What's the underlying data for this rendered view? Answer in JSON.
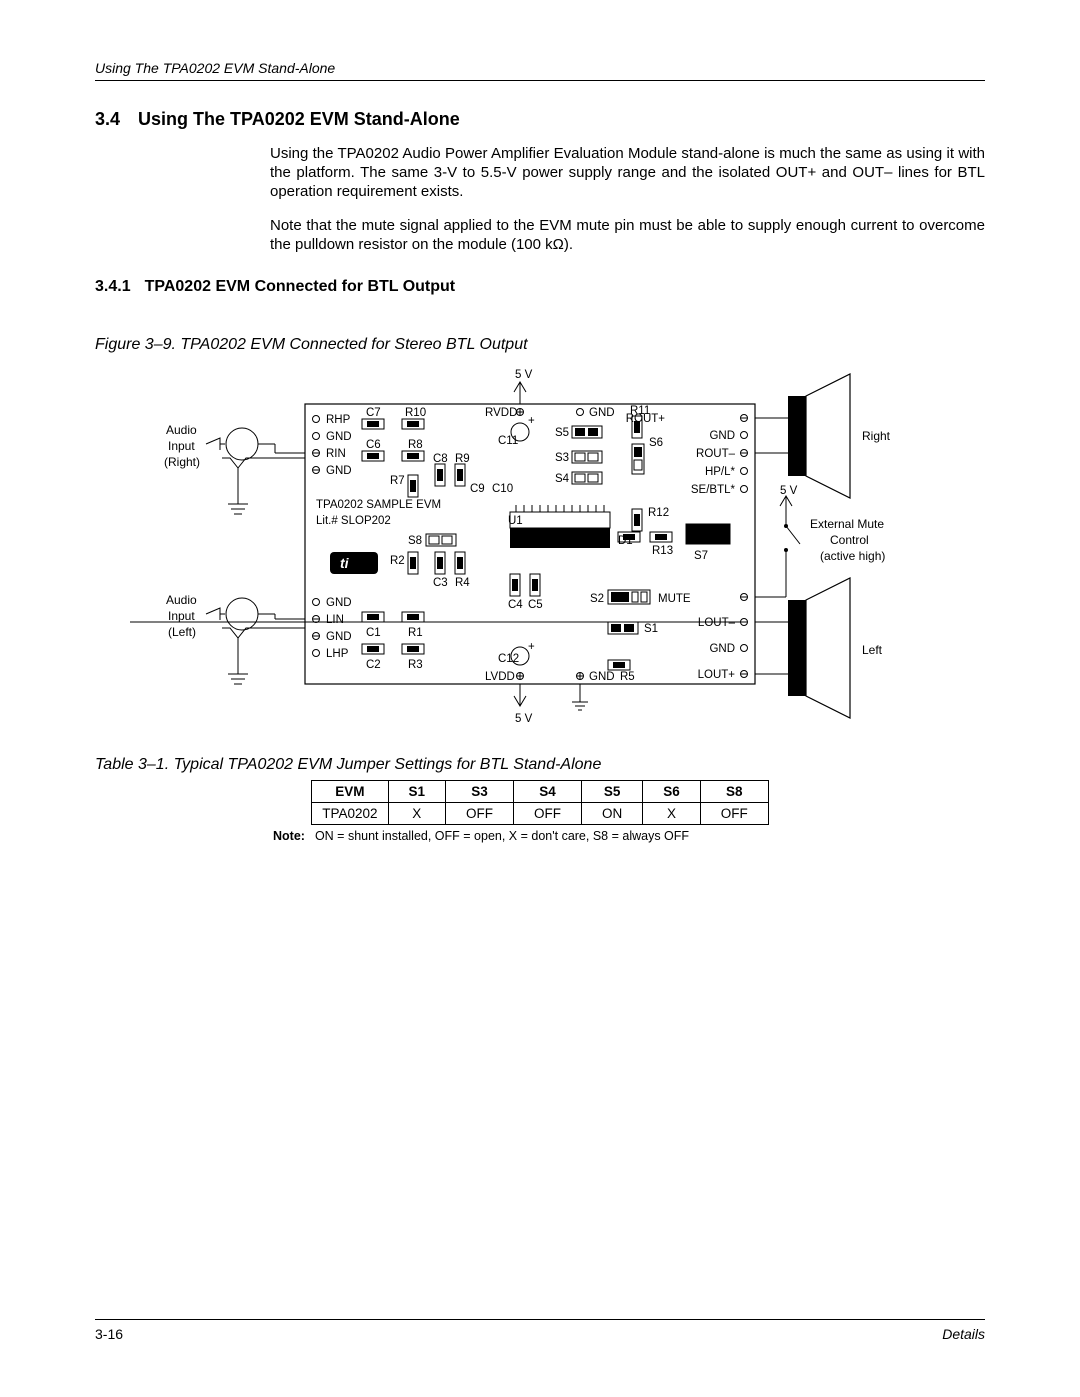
{
  "header": {
    "running": "Using The TPA0202 EVM Stand-Alone"
  },
  "section34": {
    "num": "3.4",
    "title": "Using The TPA0202 EVM Stand-Alone",
    "p1": "Using the TPA0202 Audio Power Amplifier Evaluation Module stand-alone is much the same as using it with the platform. The same 3-V to 5.5-V power supply range and the isolated OUT+ and OUT– lines for BTL operation requirement exists.",
    "p2": "Note that the mute signal applied to the EVM mute pin must be able to supply enough current to overcome the pulldown resistor on the module (100 kΩ)."
  },
  "section341": {
    "num": "3.4.1",
    "title": "TPA0202 EVM Connected for BTL Output"
  },
  "figure": {
    "caption": "Figure 3–9. TPA0202 EVM Connected for Stereo BTL Output"
  },
  "diagram": {
    "top5v": "5 V",
    "bot5v": "5 V",
    "right5v": "5 V",
    "audioR1": "Audio",
    "audioR2": "Input",
    "audioR3": "(Right)",
    "audioL1": "Audio",
    "audioL2": "Input",
    "audioL3": "(Left)",
    "rhp": "RHP",
    "gnd": "GND",
    "rin": "RIN",
    "c7": "C7",
    "r10": "R10",
    "c6": "C6",
    "r8": "R8",
    "c8": "C8",
    "r9": "R9",
    "r7": "R7",
    "c9": "C9",
    "c10": "C10",
    "rvdd": "RVDD",
    "c11": "C11",
    "plus": "+",
    "s5": "S5",
    "s3": "S3",
    "s4": "S4",
    "r11": "R11",
    "s6": "S6",
    "routp": "ROUT+",
    "routm": "ROUT–",
    "hpl": "HP/L*",
    "sebtl": "SE/BTL*",
    "sample1": "TPA0202  SAMPLE EVM",
    "sample2": "Lit.# SLOP202",
    "u1": "U1",
    "s8": "S8",
    "r2": "R2",
    "c3": "C3",
    "r4": "R4",
    "d1": "D1",
    "r12": "R12",
    "r13": "R13",
    "s7": "S7",
    "c4": "C4",
    "c5": "C5",
    "s2": "S2",
    "mute": "MUTE",
    "lin": "LIN",
    "lhp": "LHP",
    "c1": "C1",
    "r1": "R1",
    "c2": "C2",
    "r3": "R3",
    "c12": "C12",
    "lvdd": "LVDD",
    "r5": "R5",
    "s1": "S1",
    "loutm": "LOUT–",
    "loutp": "LOUT+",
    "right": "Right",
    "left": "Left",
    "ext1": "External Mute",
    "ext2": "Control",
    "ext3": "(active high)"
  },
  "table": {
    "caption": "Table 3–1. Typical TPA0202 EVM Jumper Settings for BTL Stand-Alone",
    "headers": [
      "EVM",
      "S1",
      "S3",
      "S4",
      "S5",
      "S6",
      "S8"
    ],
    "row": [
      "TPA0202",
      "X",
      "OFF",
      "OFF",
      "ON",
      "X",
      "OFF"
    ],
    "note_label": "Note:",
    "note_text": "ON = shunt installed, OFF = open, X = don't care, S8 = always OFF"
  },
  "footer": {
    "left": "3-16",
    "right": "Details"
  }
}
